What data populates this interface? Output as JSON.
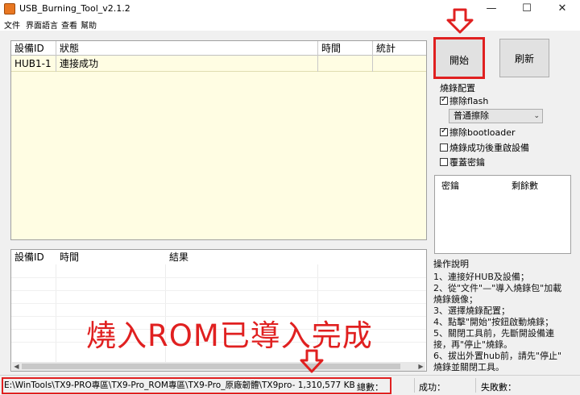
{
  "window": {
    "title": "USB_Burning_Tool_v2.1.2",
    "min": "—",
    "max": "☐",
    "close": "✕"
  },
  "menu": [
    "文件",
    "界面語言",
    "查看",
    "幫助"
  ],
  "device_table": {
    "headers": [
      "設備ID",
      "狀態",
      "時間",
      "統計"
    ],
    "rows": [
      {
        "id": "HUB1-1",
        "status": "連接成功",
        "time": "",
        "count": ""
      }
    ]
  },
  "result_table": {
    "headers": [
      "設備ID",
      "時間",
      "結果"
    ]
  },
  "buttons": {
    "start": "開始",
    "refresh": "刷新"
  },
  "burn_config": {
    "title": "燒錄配置",
    "erase_flash": {
      "label": "擦除flash",
      "checked": true
    },
    "erase_mode": "普通擦除",
    "erase_bootloader": {
      "label": "擦除bootloader",
      "checked": true
    },
    "reboot_after": {
      "label": "燒錄成功後重啟設備",
      "checked": false
    },
    "overwrite_key": {
      "label": "覆蓋密鑰",
      "checked": false
    }
  },
  "key_table": {
    "headers": [
      "密鑰",
      "剩餘數"
    ]
  },
  "help": {
    "title": "操作說明",
    "lines": [
      "1、連接好HUB及設備；",
      "2、從\"文件\"—\"導入燒錄包\"加載",
      "燒錄鏡像；",
      "3、選擇燒錄配置；",
      "4、點擊\"開始\"按鈕啟動燒錄；",
      "5、關閉工具前，先斷開設備連",
      "接，再\"停止\"燒錄。",
      "6、拔出外置hub前，請先\"停止\"",
      "燒錄並關閉工具。"
    ]
  },
  "overlay_note": "燒入ROM已導入完成",
  "status": {
    "path": "E:\\WinTools\\TX9-PRO專區\\TX9-Pro_ROM專區\\TX9-Pro_原廠韌體\\TX9pro- 1,310,577 KB",
    "total": "總數：",
    "success": "成功：",
    "fail": "失敗數："
  },
  "colors": {
    "highlight_red": "#e02020",
    "grid_bg": "#fffde3"
  }
}
